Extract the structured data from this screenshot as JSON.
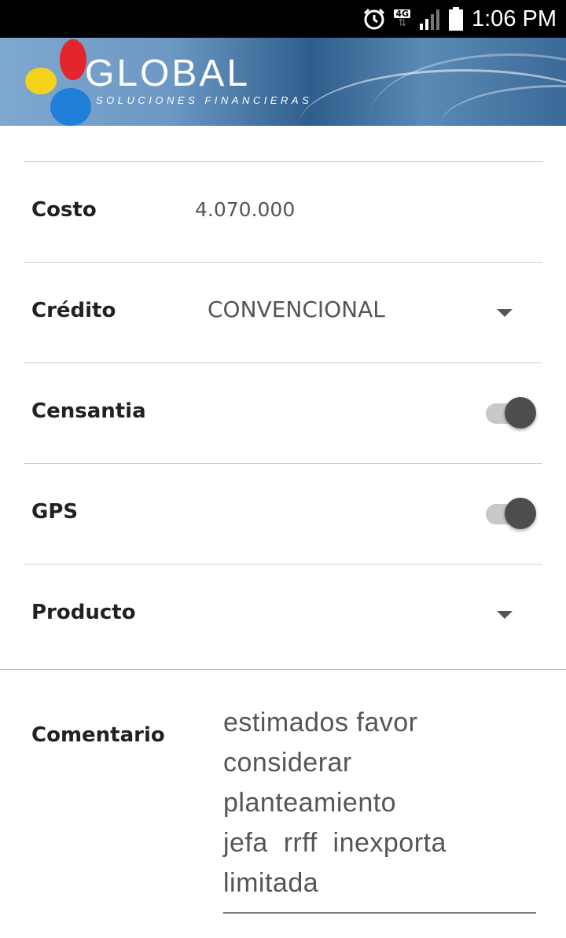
{
  "status_bar": {
    "time": "1:06 PM",
    "network_badge": "4G",
    "icons": [
      "alarm-icon",
      "4g-data-icon",
      "signal-icon",
      "battery-icon"
    ]
  },
  "header": {
    "logo_title": "GLOBAL",
    "logo_subtitle": "SOLUCIONES FINANCIERAS",
    "logo_colors": [
      "#e3262b",
      "#f5d31b",
      "#1f7fd9"
    ]
  },
  "form": {
    "costo": {
      "label": "Costo",
      "value": "4.070.000"
    },
    "credito": {
      "label": "Crédito",
      "value": "CONVENCIONAL"
    },
    "censantia": {
      "label": "Censantia",
      "on": true
    },
    "gps": {
      "label": "GPS",
      "on": true
    },
    "producto": {
      "label": "Producto",
      "value": ""
    },
    "comentario": {
      "label": "Comentario",
      "value": "estimados favor\nconsiderar\nplanteamiento\njefa  rrff  inexporta\nlimitada"
    }
  }
}
